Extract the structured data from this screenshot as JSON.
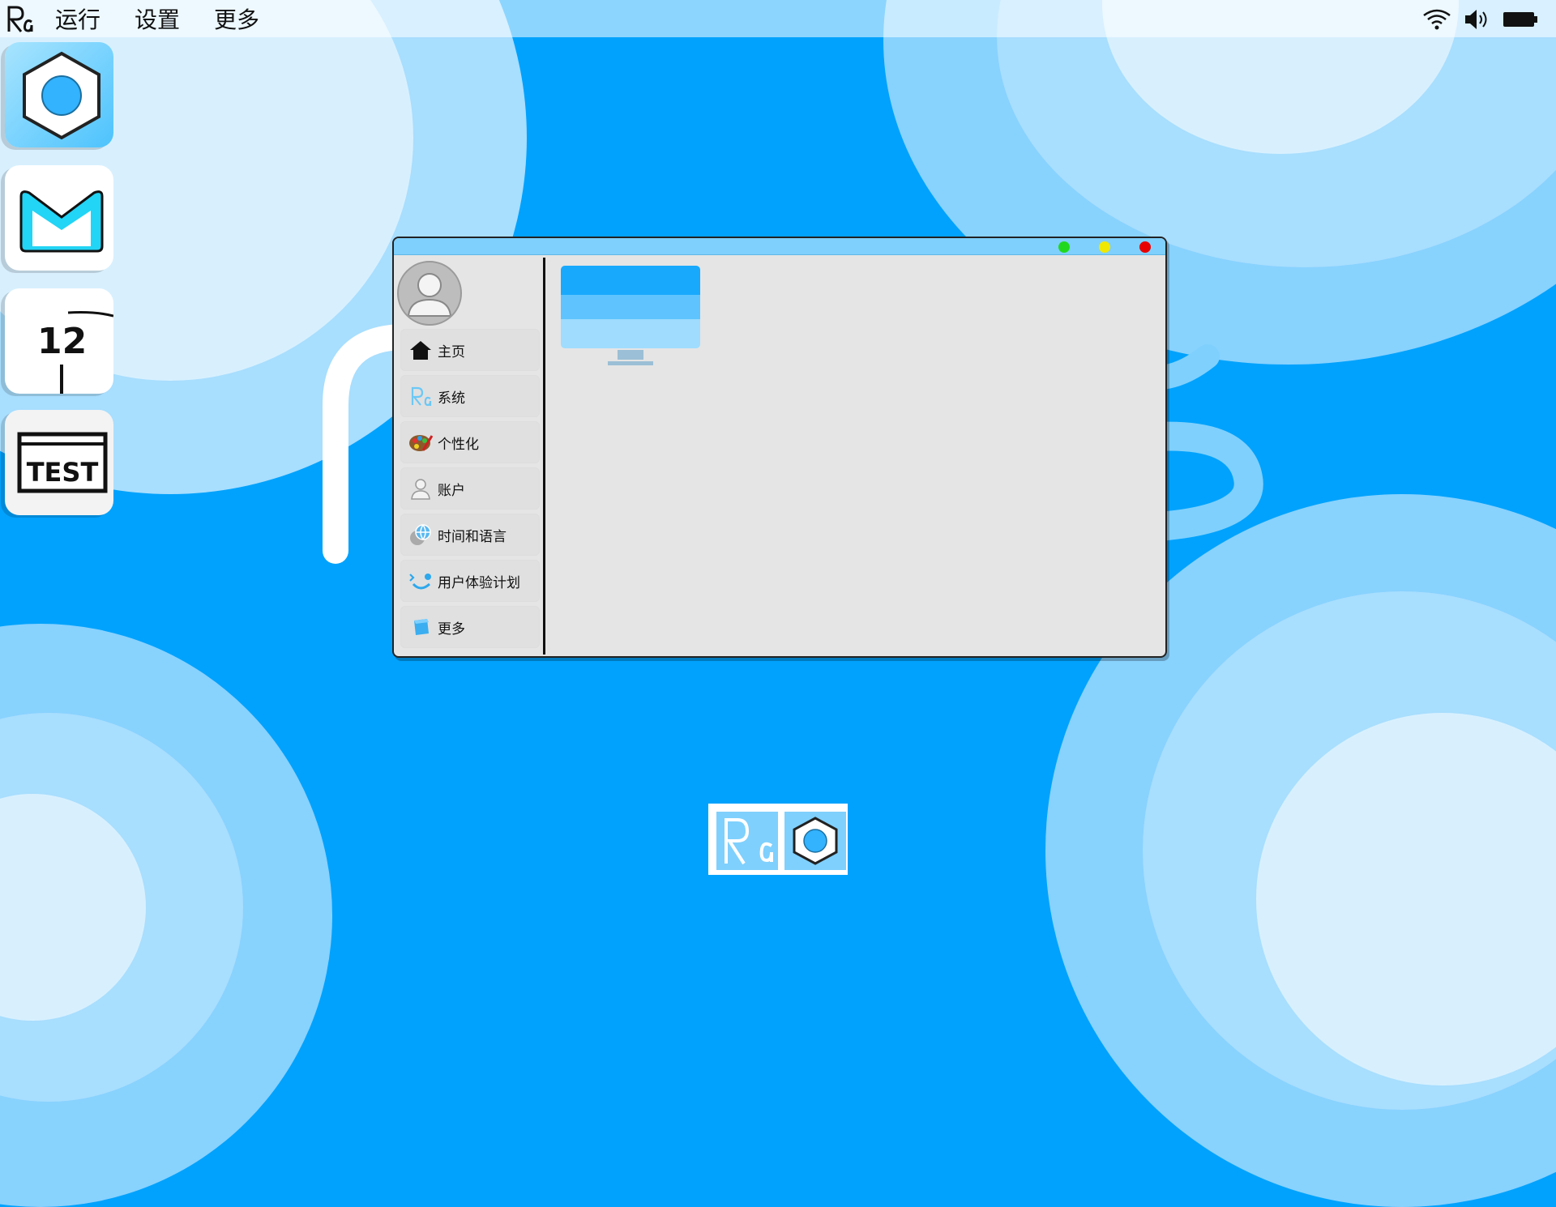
{
  "menubar": {
    "logo_text": "Ra",
    "items": [
      "运行",
      "设置",
      "更多"
    ],
    "status_icons": [
      "wifi-icon",
      "speaker-icon",
      "battery-icon"
    ]
  },
  "dock_apps": [
    {
      "name": "hexagon-app",
      "icon": "hexagon-icon"
    },
    {
      "name": "mail-app",
      "icon": "mail-icon"
    },
    {
      "name": "clock-app",
      "icon": "clock-icon",
      "text": "12"
    },
    {
      "name": "test-app",
      "icon": "test-icon",
      "text": "TEST"
    }
  ],
  "window": {
    "controls": {
      "green": "#22d81e",
      "yellow": "#f0e800",
      "red": "#e80000"
    },
    "nav": [
      {
        "label": "主页",
        "icon": "home-icon"
      },
      {
        "label": "系统",
        "icon": "ra-logo-icon"
      },
      {
        "label": "个性化",
        "icon": "palette-icon"
      },
      {
        "label": "账户",
        "icon": "user-icon"
      },
      {
        "label": "时间和语言",
        "icon": "globe-clock-icon"
      },
      {
        "label": "用户体验计划",
        "icon": "smile-icon"
      },
      {
        "label": "更多",
        "icon": "cube-icon"
      }
    ]
  },
  "taskbar": {
    "items": [
      {
        "name": "ra-logo-task",
        "icon": "ra-logo-icon"
      },
      {
        "name": "hexagon-task",
        "icon": "hexagon-icon"
      }
    ]
  },
  "colors": {
    "desktop": "#01a2fd",
    "accent": "#7fd0fd",
    "window_bg": "#e5e5e5"
  }
}
